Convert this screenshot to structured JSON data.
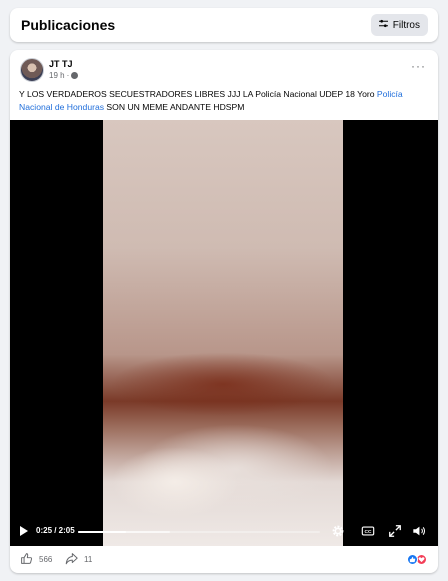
{
  "header": {
    "title": "Publicaciones",
    "filter_label": "Filtros"
  },
  "post": {
    "author": "JT TJ",
    "time": "19 h",
    "text_main": "Y LOS VERDADEROS SECUESTRADORES LIBRES JJJ LA Policía Nacional UDEP 18 Yoro ",
    "text_link": "Policía Nacional de Honduras",
    "text_tail": "  SON UN MEME ANDANTE HDSPM",
    "link_color": "#216fdb"
  },
  "video": {
    "time_display": "0:25 / 2:05",
    "progress_fraction": 0.2,
    "buffered_fraction": 0.38,
    "icons": [
      "play-icon",
      "settings-icon",
      "captions-icon",
      "fullscreen-icon",
      "volume-icon"
    ]
  },
  "actions": {
    "like_count": "566",
    "share_count": "11",
    "reaction_icons": [
      "like-reaction-icon",
      "love-reaction-icon"
    ]
  }
}
